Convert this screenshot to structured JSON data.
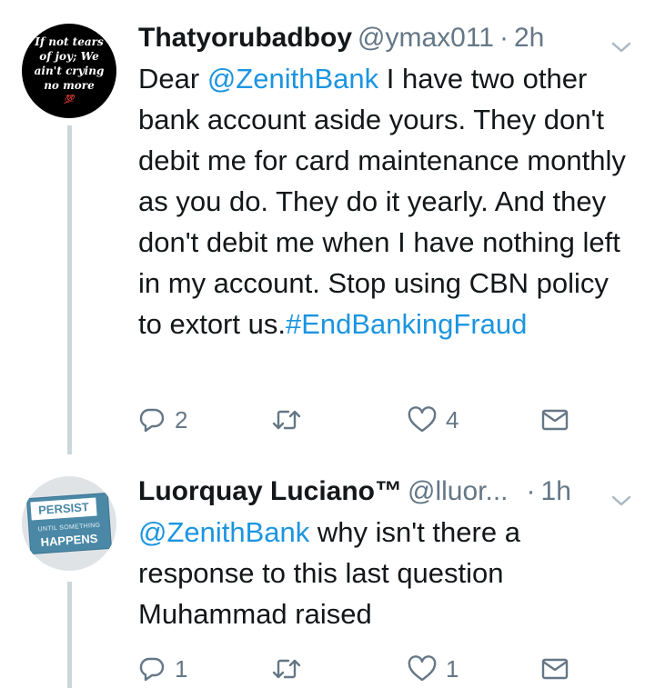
{
  "tweets": [
    {
      "avatar": {
        "lines": [
          "If not tears",
          "of joy; We",
          "ain't crying",
          "no more"
        ],
        "emoji": "💯"
      },
      "author": {
        "name": "Thatyorubadboy",
        "handle": "@ymax011",
        "separator": "·",
        "time": "2h"
      },
      "body": {
        "pre": "Dear ",
        "mention": "@ZenithBank",
        "text": " I have two other bank account aside yours. They don't debit me for card maintenance monthly as you do. They do it yearly. And they don't debit me when I have nothing left in my account. Stop using CBN policy to extort us.",
        "hashtag": "#EndBankingFraud"
      },
      "actions": {
        "replies": "2",
        "retweets": "",
        "likes": "4"
      },
      "icons": [
        "reply-icon",
        "retweet-icon",
        "heart-icon",
        "direct-message-icon",
        "chevron-down-icon"
      ]
    },
    {
      "avatar": {
        "persist": "PERSIST",
        "until": "UNTIL SOMETHING",
        "happens": "HAPPENS"
      },
      "author": {
        "name": "Luorquay Luciano™",
        "handle": "@lluor...",
        "separator": "·",
        "time": "1h"
      },
      "body": {
        "mention": "@ZenithBank",
        "text": " why isn't there a response to this last question Muhammad raised"
      },
      "actions": {
        "replies": "1",
        "retweets": "",
        "likes": "1"
      },
      "icons": [
        "reply-icon",
        "retweet-icon",
        "heart-icon",
        "direct-message-icon",
        "chevron-down-icon"
      ]
    }
  ],
  "colors": {
    "link": "#1b95e0",
    "meta": "#657786",
    "text": "#14171a",
    "thread": "#ccd6dd"
  }
}
